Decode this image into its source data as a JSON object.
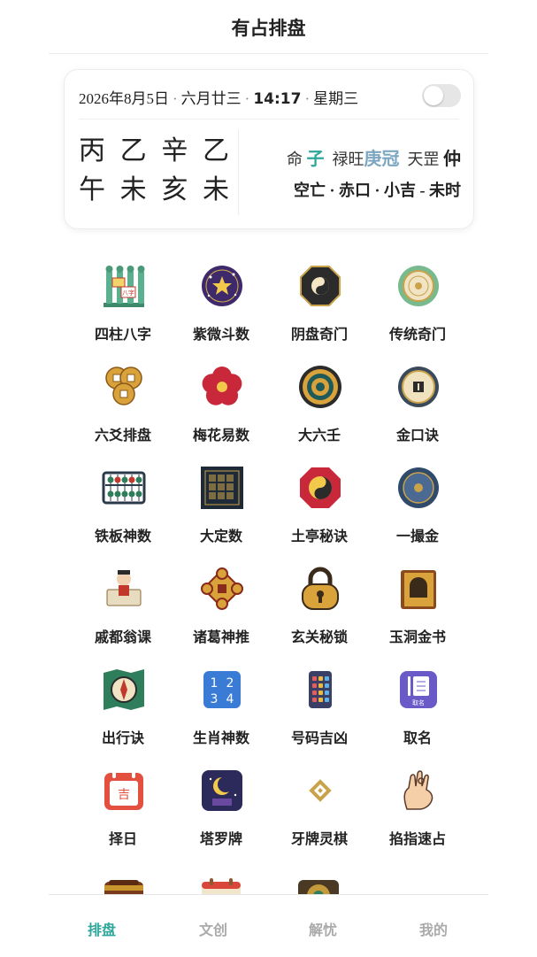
{
  "header": {
    "title": "有占排盘"
  },
  "card": {
    "date": "2026年8月5日",
    "lunar": "六月廿三",
    "time": "14:17",
    "weekday": "星期三",
    "pillars_top": [
      "丙",
      "乙",
      "辛",
      "乙"
    ],
    "pillars_bottom": [
      "午",
      "未",
      "亥",
      "未"
    ],
    "ming_label": "命",
    "ming_value": "子",
    "luwang_label": "禄旺",
    "luwang_value": "庚冠",
    "tiangang_label": "天罡",
    "tiangang_value": "仲",
    "info2": "空亡 · 赤口 · 小吉 - 未时"
  },
  "tools": [
    {
      "label": "四柱八字",
      "icon": "four-pillars-icon"
    },
    {
      "label": "紫微斗数",
      "icon": "star-chart-icon"
    },
    {
      "label": "阴盘奇门",
      "icon": "bagua-icon"
    },
    {
      "label": "传统奇门",
      "icon": "jade-disc-icon"
    },
    {
      "label": "六爻排盘",
      "icon": "coins-icon"
    },
    {
      "label": "梅花易数",
      "icon": "plum-blossom-icon"
    },
    {
      "label": "大六壬",
      "icon": "compass-wheel-icon"
    },
    {
      "label": "金口诀",
      "icon": "gold-medallion-icon"
    },
    {
      "label": "铁板神数",
      "icon": "abacus-icon"
    },
    {
      "label": "大定数",
      "icon": "number-board-icon"
    },
    {
      "label": "土亭秘诀",
      "icon": "taiji-bagua-icon"
    },
    {
      "label": "一撮金",
      "icon": "blue-disc-icon"
    },
    {
      "label": "戚都翁课",
      "icon": "sage-icon"
    },
    {
      "label": "诸葛神推",
      "icon": "gold-knot-icon"
    },
    {
      "label": "玄关秘锁",
      "icon": "lock-icon"
    },
    {
      "label": "玉洞金书",
      "icon": "book-icon"
    },
    {
      "label": "出行诀",
      "icon": "map-compass-icon"
    },
    {
      "label": "生肖神数",
      "icon": "number-grid-icon"
    },
    {
      "label": "号码吉凶",
      "icon": "phone-keypad-icon"
    },
    {
      "label": "取名",
      "icon": "naming-icon"
    },
    {
      "label": "择日",
      "icon": "calendar-icon"
    },
    {
      "label": "塔罗牌",
      "icon": "tarot-icon"
    },
    {
      "label": "牙牌灵棋",
      "icon": "diamond-icon"
    },
    {
      "label": "掐指速占",
      "icon": "hand-icon"
    }
  ],
  "tools_icon_text": {
    "bazi": "八字",
    "ji": "吉",
    "name": "取名",
    "nums": [
      "1",
      "2",
      "3",
      "4"
    ]
  },
  "tabs": [
    {
      "label": "排盘",
      "active": true
    },
    {
      "label": "文创",
      "active": false
    },
    {
      "label": "解忧",
      "active": false
    },
    {
      "label": "我的",
      "active": false
    }
  ],
  "colors": {
    "accent": "#2fa69a",
    "inactive_tab": "#aaaaaa"
  }
}
